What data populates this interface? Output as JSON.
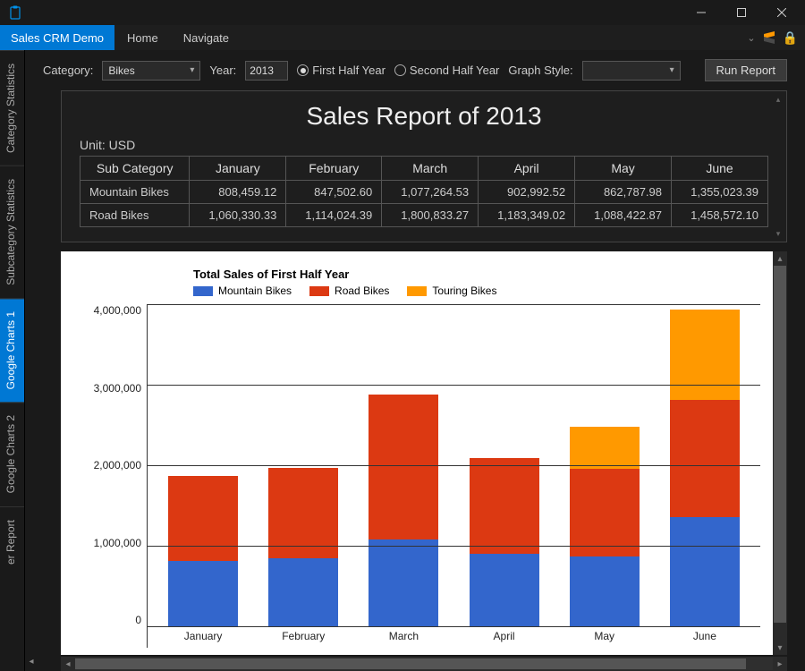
{
  "window": {
    "app_name": "Sales CRM Demo",
    "menu": [
      "Home",
      "Navigate"
    ]
  },
  "sidebar_tabs": [
    {
      "label": "Category Statistics",
      "active": false
    },
    {
      "label": "Subcategory Statistics",
      "active": false
    },
    {
      "label": "Google Charts 1",
      "active": true
    },
    {
      "label": "Google Charts 2",
      "active": false
    },
    {
      "label": "er Report",
      "active": false
    }
  ],
  "filters": {
    "category_label": "Category:",
    "category_value": "Bikes",
    "year_label": "Year:",
    "year_value": "2013",
    "radio1": "First Half Year",
    "radio2": "Second Half Year",
    "radio_selected": 1,
    "graph_style_label": "Graph Style:",
    "graph_style_value": "",
    "run_button": "Run Report"
  },
  "report": {
    "title": "Sales Report of 2013",
    "unit": "Unit: USD",
    "columns": [
      "Sub Category",
      "January",
      "February",
      "March",
      "April",
      "May",
      "June"
    ],
    "rows": [
      [
        "Mountain Bikes",
        "808,459.12",
        "847,502.60",
        "1,077,264.53",
        "902,992.52",
        "862,787.98",
        "1,355,023.39"
      ],
      [
        "Road Bikes",
        "1,060,330.33",
        "1,114,024.39",
        "1,800,833.27",
        "1,183,349.02",
        "1,088,422.87",
        "1,458,572.10"
      ]
    ]
  },
  "chart_data": {
    "type": "bar",
    "stacked": true,
    "title": "Total Sales of First Half Year",
    "series": [
      {
        "name": "Mountain Bikes",
        "color": "#3366cc",
        "values": [
          808459,
          847503,
          1077265,
          902993,
          862788,
          1355023
        ]
      },
      {
        "name": "Road Bikes",
        "color": "#dc3912",
        "values": [
          1060330,
          1114024,
          1800833,
          1183349,
          1088423,
          1458572
        ]
      },
      {
        "name": "Touring Bikes",
        "color": "#ff9900",
        "values": [
          0,
          0,
          0,
          0,
          530000,
          1120000
        ]
      }
    ],
    "categories": [
      "January",
      "February",
      "March",
      "April",
      "May",
      "June"
    ],
    "ylim": [
      0,
      4000000
    ],
    "yticks": [
      "4,000,000",
      "3,000,000",
      "2,000,000",
      "1,000,000",
      "0"
    ],
    "xlabel": "",
    "ylabel": ""
  }
}
